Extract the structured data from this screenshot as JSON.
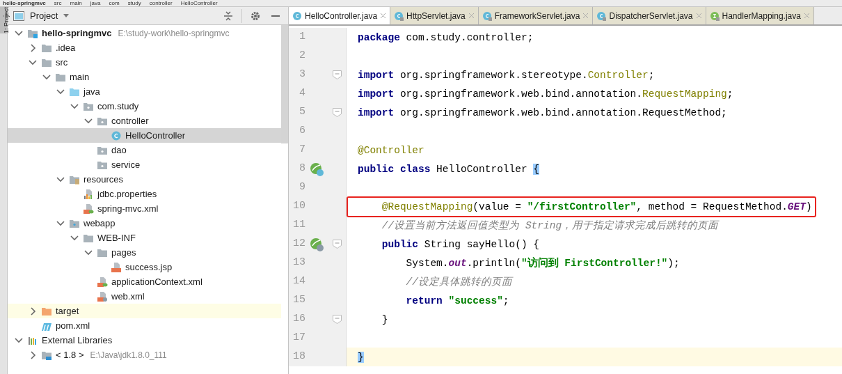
{
  "breadcrumb": [
    "hello-springmvc",
    "src",
    "main",
    "java",
    "com",
    "study",
    "controller",
    "HelloController"
  ],
  "tool_stripe": {
    "label": "1: Project"
  },
  "project_panel": {
    "title": "Project",
    "tree": [
      {
        "label": "hello-springmvc",
        "kind": "module",
        "bold": true,
        "hint": "E:\\study-work\\hello-springmvc",
        "expanded": true,
        "children": [
          {
            "label": ".idea",
            "kind": "folder",
            "expanded": false
          },
          {
            "label": "src",
            "kind": "folder",
            "expanded": true,
            "children": [
              {
                "label": "main",
                "kind": "folder",
                "expanded": true,
                "children": [
                  {
                    "label": "java",
                    "kind": "source",
                    "expanded": true,
                    "children": [
                      {
                        "label": "com.study",
                        "kind": "package",
                        "expanded": true,
                        "children": [
                          {
                            "label": "controller",
                            "kind": "package",
                            "expanded": true,
                            "children": [
                              {
                                "label": "HelloController",
                                "kind": "class",
                                "selected": true
                              }
                            ]
                          },
                          {
                            "label": "dao",
                            "kind": "package"
                          },
                          {
                            "label": "service",
                            "kind": "package"
                          }
                        ]
                      }
                    ]
                  },
                  {
                    "label": "resources",
                    "kind": "resources",
                    "expanded": true,
                    "children": [
                      {
                        "label": "jdbc.properties",
                        "kind": "properties"
                      },
                      {
                        "label": "spring-mvc.xml",
                        "kind": "spring"
                      }
                    ]
                  },
                  {
                    "label": "webapp",
                    "kind": "web",
                    "expanded": true,
                    "children": [
                      {
                        "label": "WEB-INF",
                        "kind": "folder",
                        "expanded": true,
                        "children": [
                          {
                            "label": "pages",
                            "kind": "folder",
                            "expanded": true,
                            "children": [
                              {
                                "label": "success.jsp",
                                "kind": "jsp"
                              }
                            ]
                          },
                          {
                            "label": "applicationContext.xml",
                            "kind": "spring"
                          },
                          {
                            "label": "web.xml",
                            "kind": "webxml"
                          }
                        ]
                      }
                    ]
                  }
                ]
              }
            ]
          },
          {
            "label": "target",
            "kind": "excluded",
            "expanded": false,
            "highlighted": true
          },
          {
            "label": "pom.xml",
            "kind": "maven"
          }
        ]
      },
      {
        "label": "External Libraries",
        "kind": "libraries",
        "expanded": true,
        "children": [
          {
            "label": "< 1.8 >",
            "kind": "jdk",
            "hint": "E:\\Java\\jdk1.8.0_111",
            "expanded": false
          }
        ]
      }
    ]
  },
  "editor": {
    "tabs": [
      {
        "label": "HelloController.java",
        "kind": "class",
        "selected": true
      },
      {
        "label": "HttpServlet.java",
        "kind": "library",
        "selected": false
      },
      {
        "label": "FrameworkServlet.java",
        "kind": "library",
        "selected": false
      },
      {
        "label": "DispatcherServlet.java",
        "kind": "library",
        "selected": false
      },
      {
        "label": "HandlerMapping.java",
        "kind": "interface",
        "selected": false
      }
    ],
    "lines": [
      {
        "number": "1",
        "tokens": [
          {
            "t": "package",
            "kind": "kw"
          },
          {
            "t": " com.study.controller;",
            "kind": "plain"
          }
        ]
      },
      {
        "number": "2"
      },
      {
        "number": "3",
        "fold": true,
        "tokens": [
          {
            "t": "import",
            "kind": "kw"
          },
          {
            "t": " org.springframework.stereotype.",
            "kind": "plain"
          },
          {
            "t": "Controller",
            "kind": "ann"
          },
          {
            "t": ";",
            "kind": "plain"
          }
        ]
      },
      {
        "number": "4",
        "tokens": [
          {
            "t": "import",
            "kind": "kw"
          },
          {
            "t": " org.springframework.web.bind.annotation.",
            "kind": "plain"
          },
          {
            "t": "RequestMapping",
            "kind": "ann"
          },
          {
            "t": ";",
            "kind": "plain"
          }
        ]
      },
      {
        "number": "5",
        "fold": true,
        "tokens": [
          {
            "t": "import",
            "kind": "kw"
          },
          {
            "t": " org.springframework.web.bind.annotation.RequestMethod;",
            "kind": "plain"
          }
        ]
      },
      {
        "number": "6"
      },
      {
        "number": "7",
        "tokens": [
          {
            "t": "@Controller",
            "kind": "ann"
          }
        ]
      },
      {
        "number": "8",
        "gutter": {
          "kind": "class"
        },
        "tokens": [
          {
            "t": "public class",
            "kind": "kw"
          },
          {
            "t": " HelloController ",
            "kind": "plain"
          },
          {
            "t": "{",
            "kind": "brace"
          }
        ]
      },
      {
        "number": "9"
      },
      {
        "number": "10",
        "boxed": true,
        "tokens": [
          {
            "t": "    @RequestMapping",
            "kind": "ann"
          },
          {
            "t": "(value = ",
            "kind": "plain"
          },
          {
            "t": "\"/firstController\"",
            "kind": "str"
          },
          {
            "t": ", method = RequestMethod.",
            "kind": "plain"
          },
          {
            "t": "GET",
            "kind": "static"
          },
          {
            "t": ")",
            "kind": "plain"
          }
        ]
      },
      {
        "number": "11",
        "tokens": [
          {
            "t": "    //设置当前方法返回值类型为 String，用于指定请求完成后跳转的页面",
            "kind": "comment"
          }
        ]
      },
      {
        "number": "12",
        "gutter": {
          "kind": "web"
        },
        "fold": true,
        "tokens": [
          {
            "t": "    public",
            "kind": "kw"
          },
          {
            "t": " String sayHello() {",
            "kind": "plain"
          }
        ]
      },
      {
        "number": "13",
        "tokens": [
          {
            "t": "        System.",
            "kind": "plain"
          },
          {
            "t": "out",
            "kind": "static"
          },
          {
            "t": ".println(",
            "kind": "plain"
          },
          {
            "t": "\"访问到 FirstController!\"",
            "kind": "str"
          },
          {
            "t": ");",
            "kind": "plain"
          }
        ]
      },
      {
        "number": "14",
        "tokens": [
          {
            "t": "        //设定具体跳转的页面",
            "kind": "comment"
          }
        ]
      },
      {
        "number": "15",
        "tokens": [
          {
            "t": "        return",
            "kind": "kw"
          },
          {
            "t": " \"success\"",
            "kind": "str"
          },
          {
            "t": ";",
            "kind": "plain"
          }
        ]
      },
      {
        "number": "16",
        "fold": true,
        "tokens": [
          {
            "t": "    }",
            "kind": "plain"
          }
        ]
      },
      {
        "number": "17"
      },
      {
        "number": "18",
        "current": true,
        "tokens": [
          {
            "t": "}",
            "kind": "brace"
          }
        ]
      }
    ]
  }
}
